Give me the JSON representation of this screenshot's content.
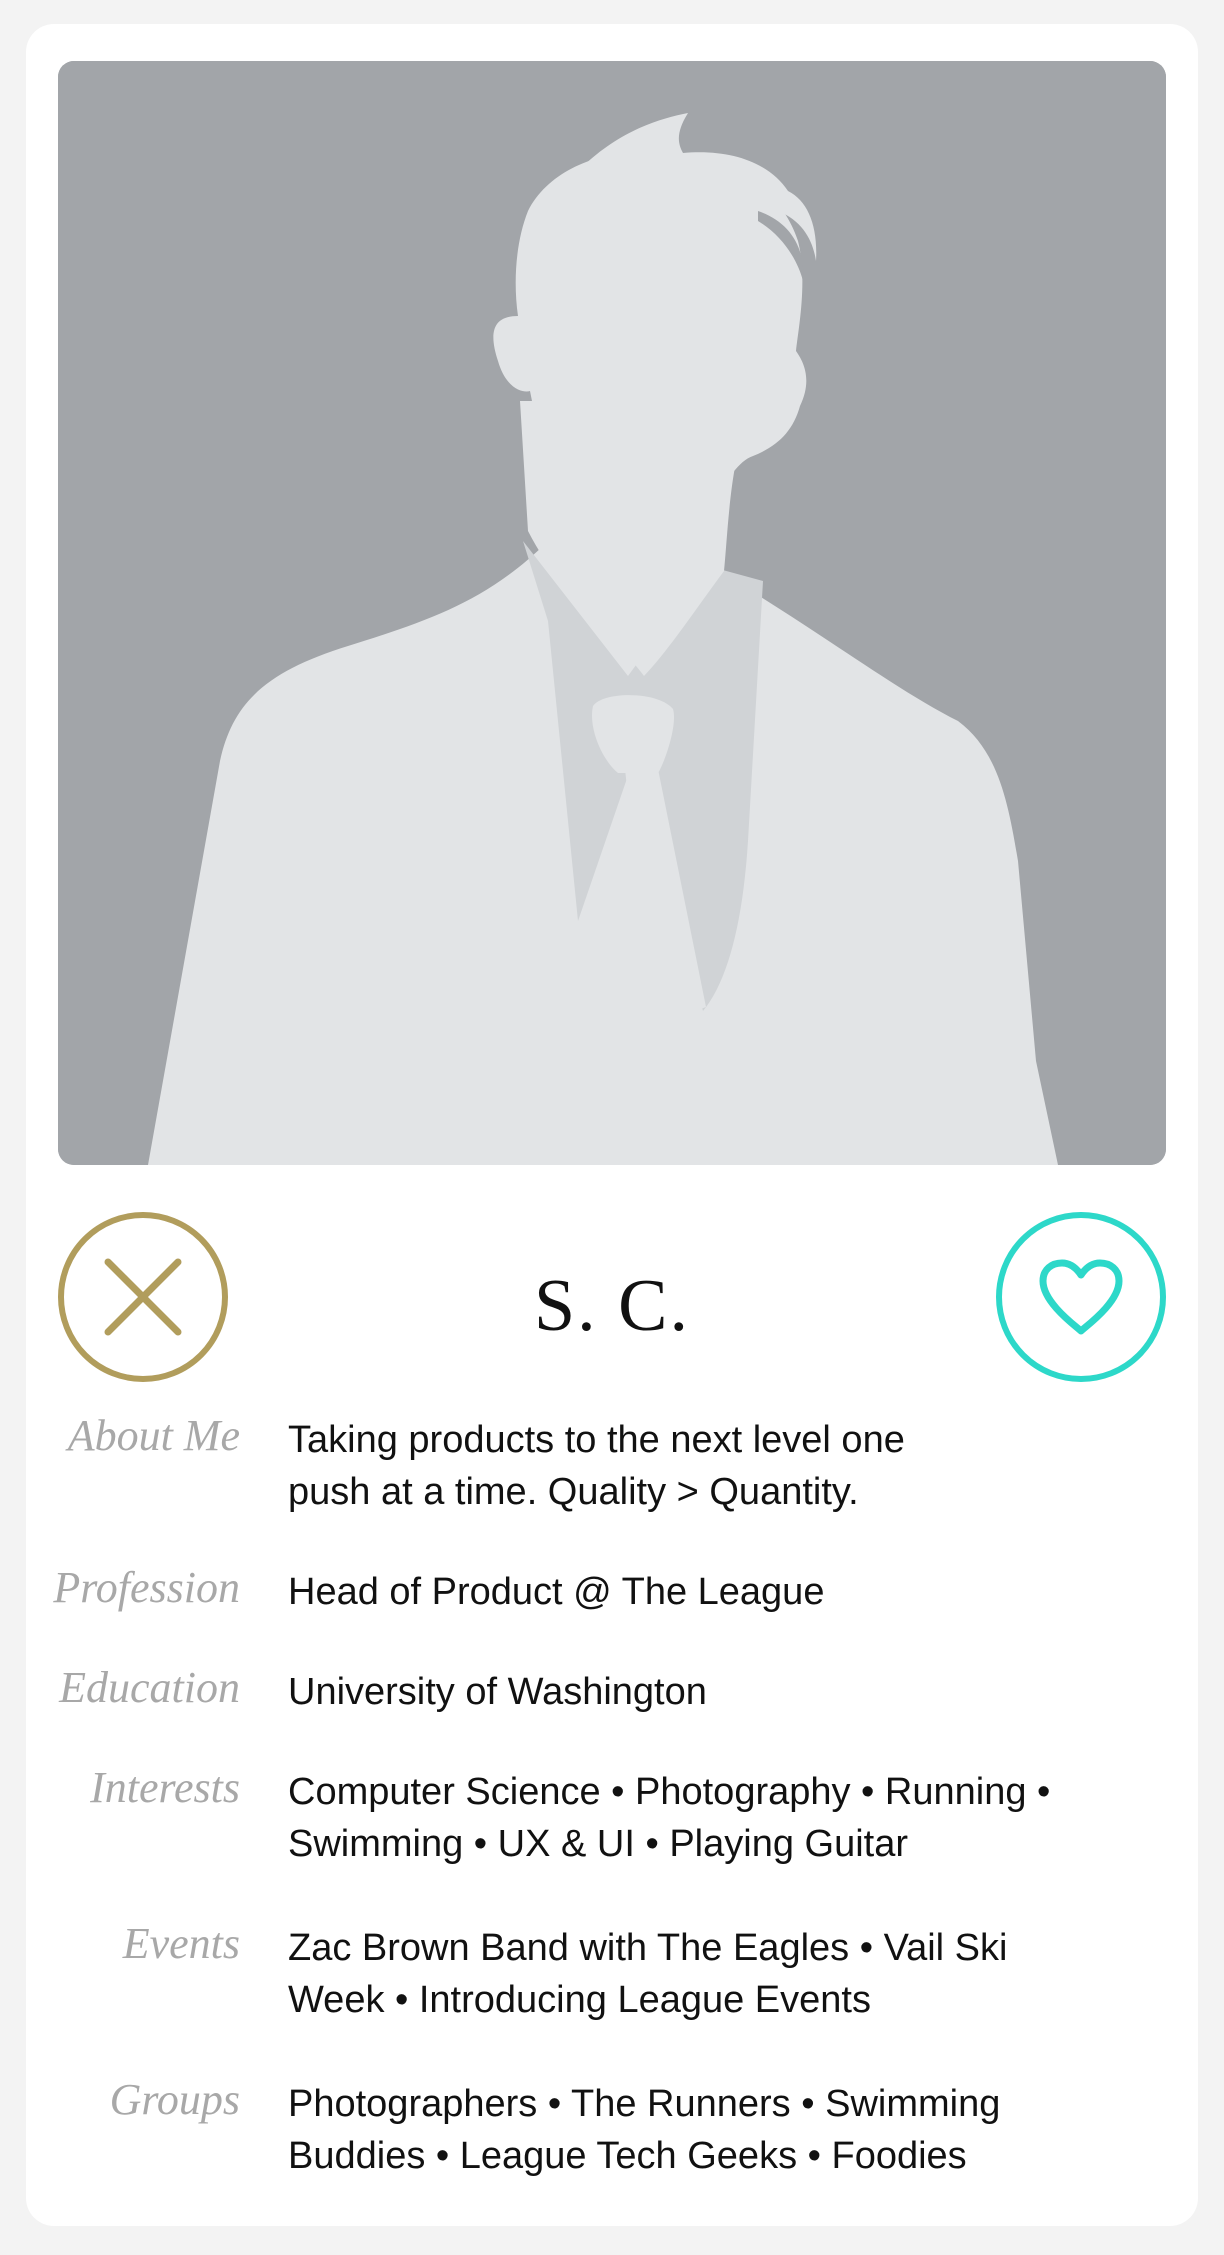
{
  "profile": {
    "name": "S. C.",
    "photo_icon": "person-silhouette-placeholder"
  },
  "actions": {
    "dislike_icon": "close-x-icon",
    "like_icon": "heart-icon",
    "dislike_color": "#b19d5c",
    "like_color": "#2dd8c9"
  },
  "details": {
    "about_me": {
      "label": "About Me",
      "value": "Taking products to the next level one push at a time. Quality > Quantity."
    },
    "profession": {
      "label": "Profession",
      "value": "Head of Product @ The League"
    },
    "education": {
      "label": "Education",
      "value": "University of Washington"
    },
    "interests": {
      "label": "Interests",
      "value": "Computer Science • Photography • Running • Swimming • UX & UI • Playing Guitar"
    },
    "events": {
      "label": "Events",
      "value": "Zac Brown Band with The Eagles • Vail Ski Week • Introducing League Events"
    },
    "groups": {
      "label": "Groups",
      "value": "Photographers • The Runners • Swimming Buddies • League Tech Geeks • Foodies"
    }
  }
}
